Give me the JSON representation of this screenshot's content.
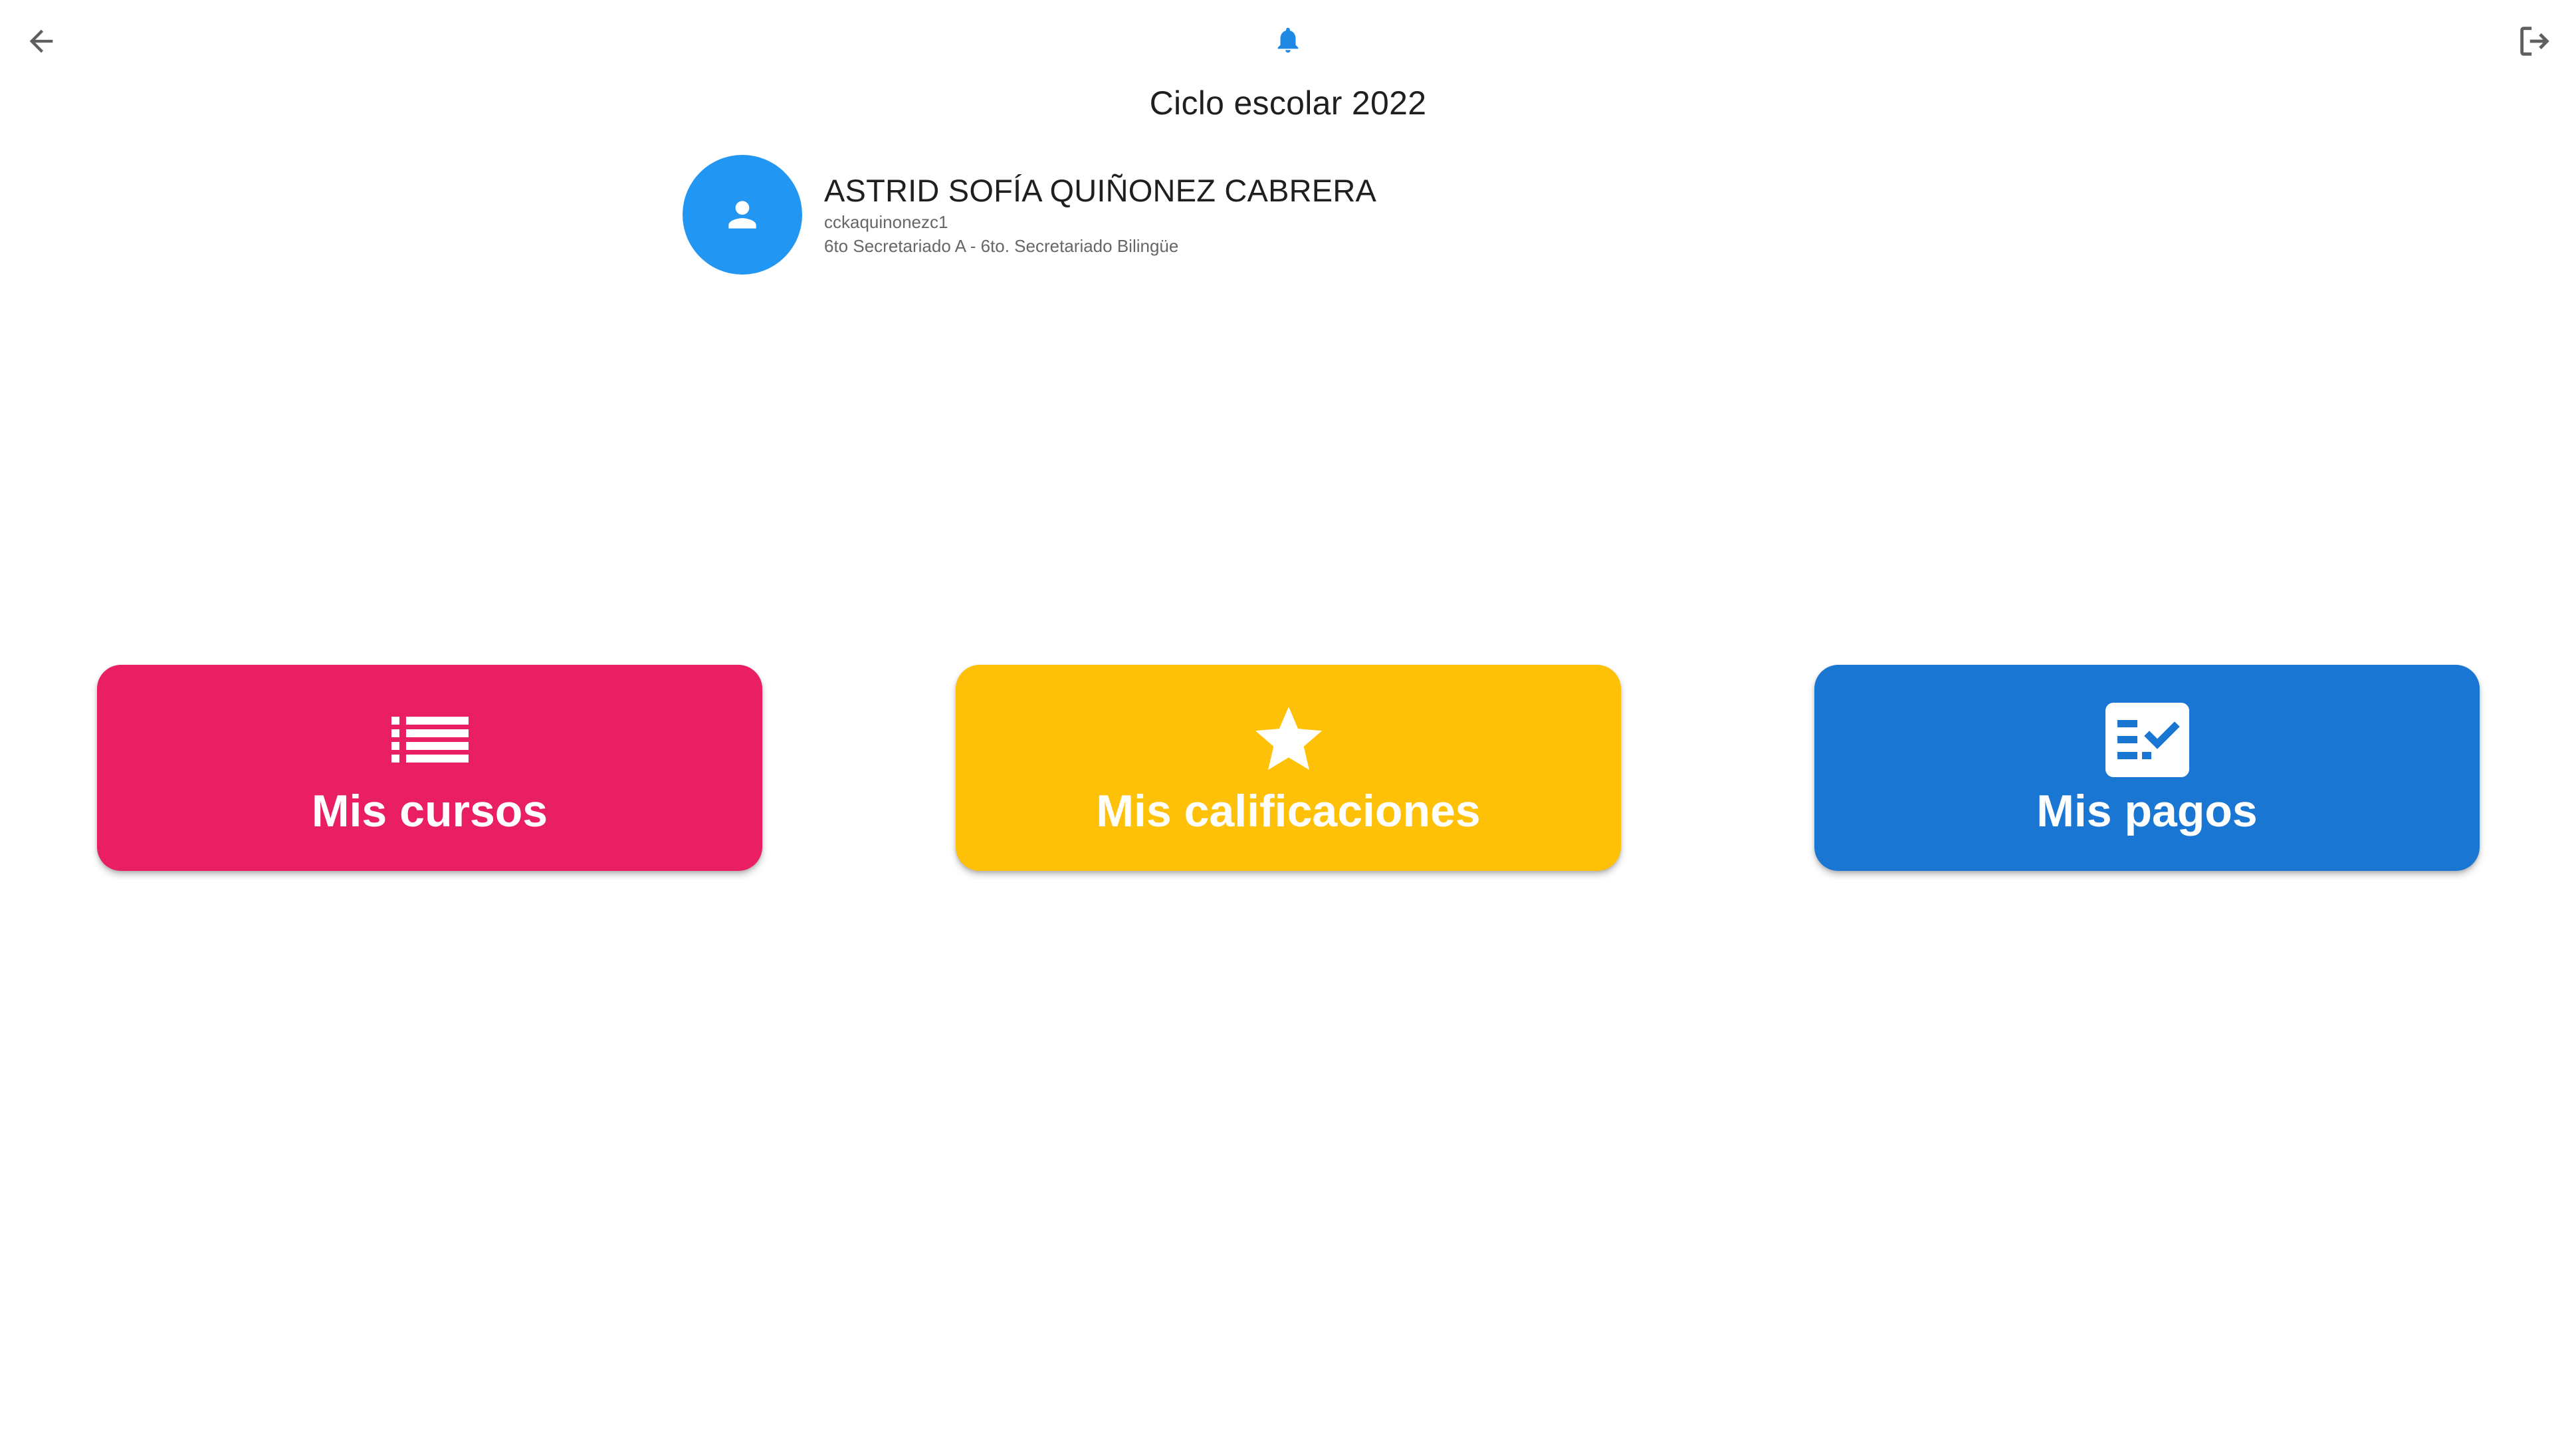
{
  "header": {
    "back_icon": "arrow-back-icon",
    "notification_icon": "bell-icon",
    "notification_color": "#1e88e5",
    "logout_icon": "logout-icon",
    "title": "Ciclo escolar 2022"
  },
  "profile": {
    "avatar_icon": "person-icon",
    "avatar_color": "#2196f3",
    "name": "ASTRID SOFÍA QUIÑONEZ CABRERA",
    "username": "cckaquinonezc1",
    "group": "6to Secretariado A - 6to. Secretariado Bilingüe"
  },
  "cards": [
    {
      "label": "Mis cursos",
      "icon": "list-icon",
      "color": "#e91e63"
    },
    {
      "label": "Mis calificaciones",
      "icon": "star-icon",
      "color": "#ffc107"
    },
    {
      "label": "Mis pagos",
      "icon": "checklist-icon",
      "color": "#1976d2"
    }
  ]
}
